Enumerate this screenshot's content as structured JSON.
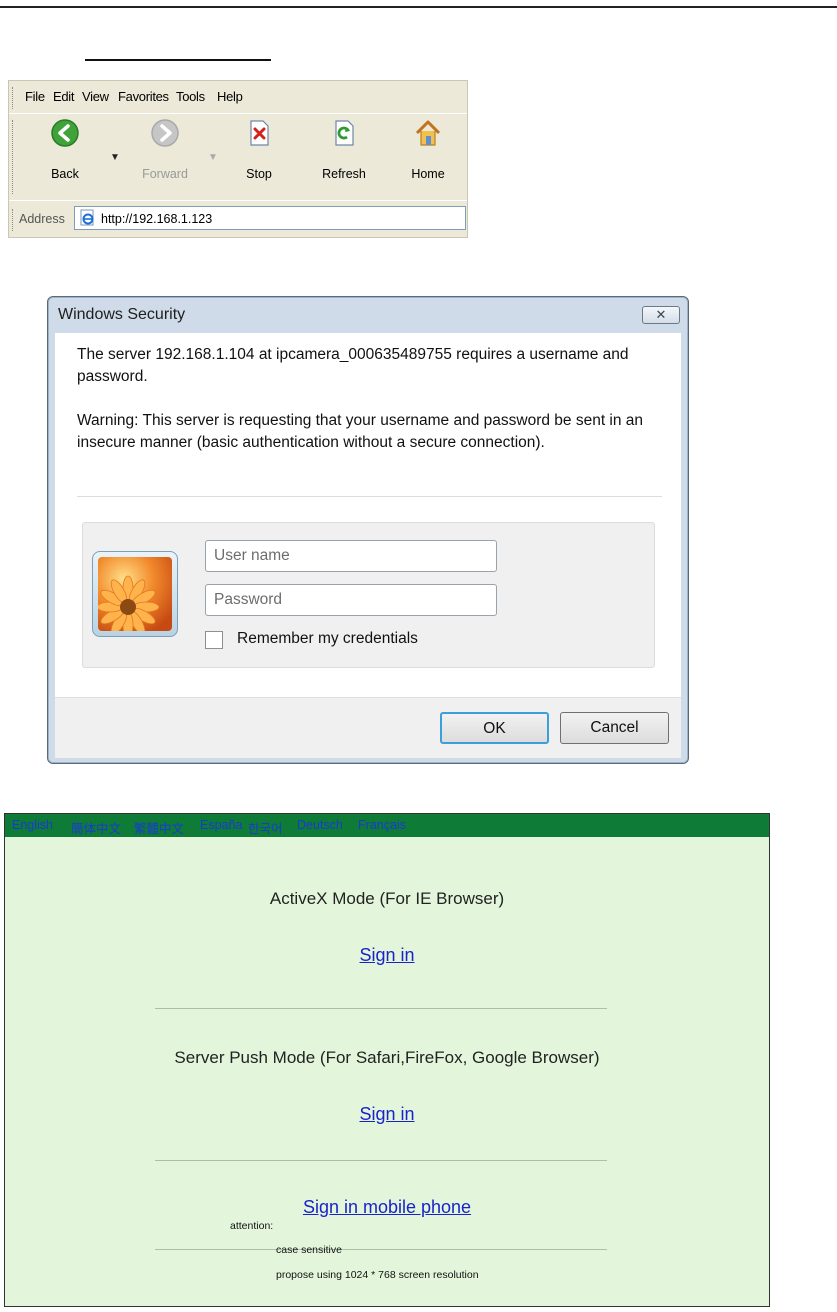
{
  "ie_toolbar": {
    "menu": [
      "File",
      "Edit",
      "View",
      "Favorites",
      "Tools",
      "Help"
    ],
    "buttons": [
      {
        "label": "Back",
        "icon": "back-arrow-icon",
        "enabled": true
      },
      {
        "label": "Forward",
        "icon": "forward-arrow-icon",
        "enabled": false
      },
      {
        "label": "Stop",
        "icon": "stop-icon",
        "enabled": true
      },
      {
        "label": "Refresh",
        "icon": "refresh-icon",
        "enabled": true
      },
      {
        "label": "Home",
        "icon": "home-icon",
        "enabled": true
      }
    ],
    "address_label": "Address",
    "address_value": "http://192.168.1.123"
  },
  "security_dialog": {
    "title": "Windows Security",
    "close_glyph": "✕",
    "message": "The server 192.168.1.104 at ipcamera_000635489755 requires a username and password.",
    "warning": "Warning: This server is requesting that your username and password be sent in an insecure manner (basic authentication without a secure connection).",
    "username_placeholder": "User name",
    "password_placeholder": "Password",
    "remember_label": "Remember my credentials",
    "ok_label": "OK",
    "cancel_label": "Cancel"
  },
  "camera_page": {
    "languages": [
      "English",
      "簡体中文",
      "繁體中文",
      "España",
      "한국어",
      "Deutsch",
      "Français"
    ],
    "activex_heading": "ActiveX Mode (For IE Browser)",
    "activex_signin": "Sign in",
    "serverpush_heading": "Server Push Mode (For Safari,FireFox, Google Browser)",
    "serverpush_signin": "Sign in",
    "mobile_signin": "Sign in mobile phone",
    "attention_label": "attention:",
    "notes": [
      "case sensitive",
      "propose using 1024 * 768 screen resolution"
    ]
  },
  "colors": {
    "lang_bar": "#0e7c37",
    "page_bg": "#e3f6dc",
    "link": "#1a23c9",
    "lang_text": "#1a39d6"
  }
}
